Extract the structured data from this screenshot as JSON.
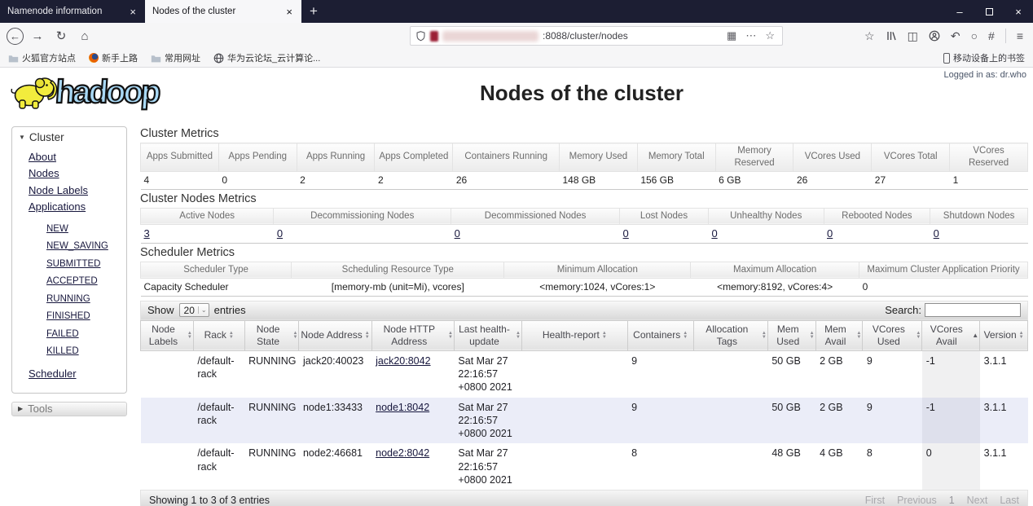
{
  "browser": {
    "tabs": [
      {
        "title": "Namenode information"
      },
      {
        "title": "Nodes of the cluster"
      }
    ],
    "new_tab_glyph": "+",
    "window": {
      "minimize": "–",
      "close": "×"
    },
    "nav": {
      "back": "←",
      "forward": "→",
      "reload": "↻",
      "home": "⌂"
    },
    "url_suffix": ":8088/cluster/nodes",
    "url_icons": {
      "qr": "▦",
      "page_actions": "⋯",
      "bookmark_star": "☆"
    },
    "toolbar_glyphs": {
      "star": "☆",
      "sidebar": "◫",
      "undo": "↶",
      "sync": "○",
      "extension": "#",
      "menu": "≡"
    },
    "bookmarks": [
      {
        "label": "火狐官方站点"
      },
      {
        "label": "新手上路"
      },
      {
        "label": "常用网址"
      },
      {
        "label": "华为云论坛_云计算论..."
      }
    ],
    "bookmarks_right": "移动设备上的书签"
  },
  "header": {
    "logo_text": "hadoop",
    "title": "Nodes of the cluster",
    "logged_in": "Logged in as: dr.who"
  },
  "sidebar": {
    "cluster_label": "Cluster",
    "links": [
      "About",
      "Nodes",
      "Node Labels",
      "Applications"
    ],
    "app_states": [
      "NEW",
      "NEW_SAVING",
      "SUBMITTED",
      "ACCEPTED",
      "RUNNING",
      "FINISHED",
      "FAILED",
      "KILLED"
    ],
    "scheduler_label": "Scheduler",
    "tools_label": "Tools"
  },
  "cluster_metrics": {
    "title": "Cluster Metrics",
    "headers": [
      "Apps Submitted",
      "Apps Pending",
      "Apps Running",
      "Apps Completed",
      "Containers Running",
      "Memory Used",
      "Memory Total",
      "Memory Reserved",
      "VCores Used",
      "VCores Total",
      "VCores Reserved"
    ],
    "values": [
      "4",
      "0",
      "2",
      "2",
      "26",
      "148 GB",
      "156 GB",
      "6 GB",
      "26",
      "27",
      "1"
    ]
  },
  "nodes_metrics": {
    "title": "Cluster Nodes Metrics",
    "headers": [
      "Active Nodes",
      "Decommissioning Nodes",
      "Decommissioned Nodes",
      "Lost Nodes",
      "Unhealthy Nodes",
      "Rebooted Nodes",
      "Shutdown Nodes"
    ],
    "values": [
      "3",
      "0",
      "0",
      "0",
      "0",
      "0",
      "0"
    ]
  },
  "scheduler_metrics": {
    "title": "Scheduler Metrics",
    "headers": [
      "Scheduler Type",
      "Scheduling Resource Type",
      "Minimum Allocation",
      "Maximum Allocation",
      "Maximum Cluster Application Priority"
    ],
    "values": [
      "Capacity Scheduler",
      "[memory-mb (unit=Mi), vcores]",
      "<memory:1024, vCores:1>",
      "<memory:8192, vCores:4>",
      "0"
    ]
  },
  "table_controls": {
    "show_label": "Show",
    "entries_value": "20",
    "entries_label": "entries",
    "search_label": "Search:"
  },
  "nodes_table": {
    "headers": [
      "Node Labels",
      "Rack",
      "Node State",
      "Node Address",
      "Node HTTP Address",
      "Last health-update",
      "Health-report",
      "Containers",
      "Allocation Tags",
      "Mem Used",
      "Mem Avail",
      "VCores Used",
      "VCores Avail",
      "Version"
    ],
    "sorted_column": "VCores Avail",
    "rows": [
      [
        "",
        "/default-rack",
        "RUNNING",
        "jack20:40023",
        "jack20:8042",
        "Sat Mar 27 22:16:57 +0800 2021",
        "",
        "9",
        "",
        "50 GB",
        "2 GB",
        "9",
        "-1",
        "3.1.1"
      ],
      [
        "",
        "/default-rack",
        "RUNNING",
        "node1:33433",
        "node1:8042",
        "Sat Mar 27 22:16:57 +0800 2021",
        "",
        "9",
        "",
        "50 GB",
        "2 GB",
        "9",
        "-1",
        "3.1.1"
      ],
      [
        "",
        "/default-rack",
        "RUNNING",
        "node2:46681",
        "node2:8042",
        "Sat Mar 27 22:16:57 +0800 2021",
        "",
        "8",
        "",
        "48 GB",
        "4 GB",
        "8",
        "0",
        "3.1.1"
      ]
    ]
  },
  "table_footer": {
    "showing": "Showing 1 to 3 of 3 entries",
    "pagination": [
      "First",
      "Previous",
      "1",
      "Next",
      "Last"
    ]
  },
  "colors": {
    "tabbar_bg": "#1c1e33",
    "hadoop_yellow": "#f2ec3d",
    "logo_blue": "#a9d9f6",
    "stripe_row": "#ebedf8"
  }
}
